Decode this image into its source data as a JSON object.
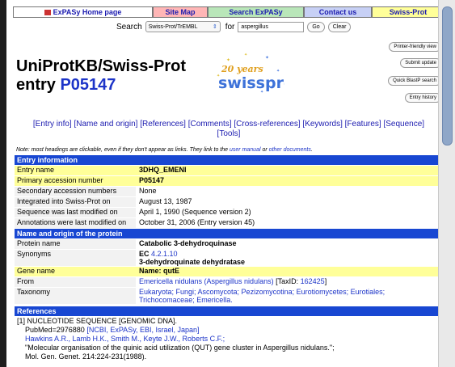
{
  "nav": {
    "home": "ExPASy Home page",
    "sitemap": "Site Map",
    "search": "Search ExPASy",
    "contact": "Contact us",
    "swissprot": "Swiss-Prot"
  },
  "searchbar": {
    "label": "Search",
    "db": "Swiss-Prot/TrEMBL",
    "for_label": "for",
    "query": "aspergillus",
    "go": "Go",
    "clear": "Clear"
  },
  "title": {
    "line1": "UniProtKB/Swiss-Prot",
    "entry_word": "entry",
    "accession": "P05147"
  },
  "logo": {
    "years": "20 years",
    "name": "swissprot"
  },
  "side_buttons": [
    "Printer-friendly view",
    "Submit update",
    "Quick BlastP search",
    "Entry history"
  ],
  "entry_links": [
    "[Entry info]",
    "[Name and origin]",
    "[References]",
    "[Comments]",
    "[Cross-references]",
    "[Keywords]",
    "[Features]",
    "[Sequence]",
    "[Tools]"
  ],
  "note": {
    "text": "Note: most headings are clickable, even if they don't appear as links. They link to the",
    "link1": "user manual",
    "mid": "or",
    "link2": "other documents",
    "end": "."
  },
  "entry_info": {
    "header": "Entry information",
    "rows": [
      {
        "k": "Entry name",
        "v": "3DHQ_EMENI"
      },
      {
        "k": "Primary accession number",
        "v": "P05147"
      },
      {
        "k": "Secondary accession numbers",
        "v": "None"
      },
      {
        "k": "Integrated into Swiss-Prot on",
        "v": "August 13, 1987"
      },
      {
        "k": "Sequence was last modified on",
        "v": "April 1, 1990 (Sequence version 2)"
      },
      {
        "k": "Annotations were last modified on",
        "v": "October 31, 2006 (Entry version 45)"
      }
    ]
  },
  "name_origin": {
    "header": "Name and origin of the protein",
    "protein_name_k": "Protein name",
    "protein_name_v": "Catabolic 3-dehydroquinase",
    "synonyms_k": "Synonyms",
    "synonyms_ec": "EC",
    "synonyms_ec_num": "4.2.1.10",
    "synonyms_v2": "3-dehydroquinate dehydratase",
    "gene_k": "Gene name",
    "gene_v": "Name: qutE",
    "from_k": "From",
    "from_org": "Emericella nidulans (Aspergillus nidulans)",
    "from_taxid_pre": "[TaxID:",
    "from_taxid": "162425",
    "from_taxid_post": "]",
    "taxonomy_k": "Taxonomy",
    "taxonomy_l1": "Eukaryota; Fungi; Ascomycota; Pezizomycotina; Eurotiomycetes; Eurotiales;",
    "taxonomy_l2": "Trichocomaceae; Emericella."
  },
  "references": {
    "header": "References",
    "r1": "[1] NUCLEOTIDE SEQUENCE [GENOMIC DNA].",
    "pubmed": "PubMed=2976880",
    "pubmed_links": "[NCBI, ExPASy, EBI, Israel, Japan]",
    "authors": "Hawkins A.R., Lamb H.K., Smith M., Keyte J.W., Roberts C.F.;",
    "ref_title": "\"Molecular organisation of the quinic acid utilization (QUT) gene cluster in Aspergillus nidulans.\";",
    "journal": "Mol. Gen. Genet. 214:224-231(1988)."
  }
}
